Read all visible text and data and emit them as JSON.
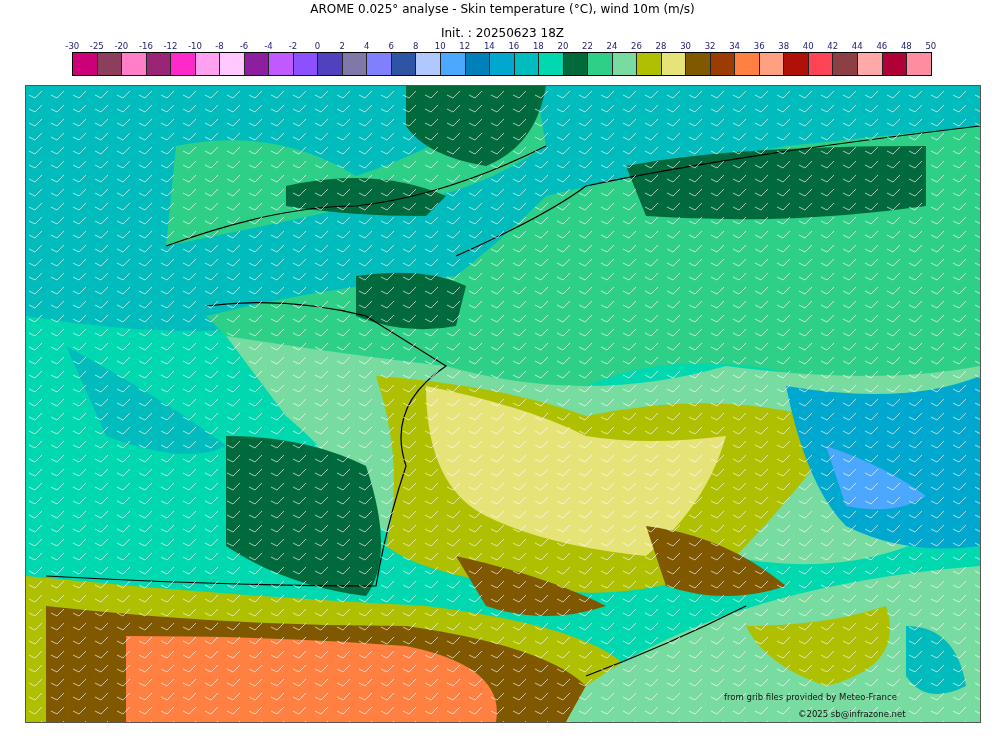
{
  "title": "AROME 0.025° analyse - Skin temperature (°C), wind 10m (m/s)",
  "init": "Init. : 20250623 18Z",
  "legend": {
    "labels": [
      "-30",
      "-25",
      "-20",
      "-16",
      "-12",
      "-10",
      "-8",
      "-6",
      "-4",
      "-2",
      "0",
      "2",
      "4",
      "6",
      "8",
      "10",
      "12",
      "14",
      "16",
      "18",
      "20",
      "22",
      "24",
      "26",
      "28",
      "30",
      "32",
      "34",
      "36",
      "38",
      "40",
      "42",
      "44",
      "46",
      "48",
      "50"
    ],
    "swatches": [
      {
        "color": "#cc0077"
      },
      {
        "color": "#8b3f5c"
      },
      {
        "color": "#ff80c8"
      },
      {
        "color": "#9b2575"
      },
      {
        "color": "#ff28c8"
      },
      {
        "color": "#ffa0f0"
      },
      {
        "color": "#ffc8ff"
      },
      {
        "color": "#8c1e9f"
      },
      {
        "color": "#be5aff"
      },
      {
        "color": "#8c50ff"
      },
      {
        "color": "#5042be"
      },
      {
        "color": "#8078a8"
      },
      {
        "color": "#8080ff"
      },
      {
        "color": "#2e54a6"
      },
      {
        "color": "#b0c8ff"
      },
      {
        "color": "#4ca8ff"
      },
      {
        "color": "#0080b8"
      },
      {
        "color": "#00a8d0"
      },
      {
        "color": "#00bcbc"
      },
      {
        "color": "#00d8b0"
      },
      {
        "color": "#006a3c"
      },
      {
        "color": "#2ed088"
      },
      {
        "color": "#78dca0"
      },
      {
        "color": "#aec000"
      },
      {
        "color": "#e6e478"
      },
      {
        "color": "#805800"
      },
      {
        "color": "#9c3c00"
      },
      {
        "color": "#ff8040"
      },
      {
        "color": "#ffa080"
      },
      {
        "color": "#b01008"
      },
      {
        "color": "#ff4458"
      },
      {
        "color": "#8c4044"
      },
      {
        "color": "#ffa8a8"
      },
      {
        "color": "#b00038"
      },
      {
        "color": "#ff8ca0"
      }
    ]
  },
  "credits": [
    "from grib files provided by Meteo-France",
    "©2025 sb@infrazone.net"
  ]
}
